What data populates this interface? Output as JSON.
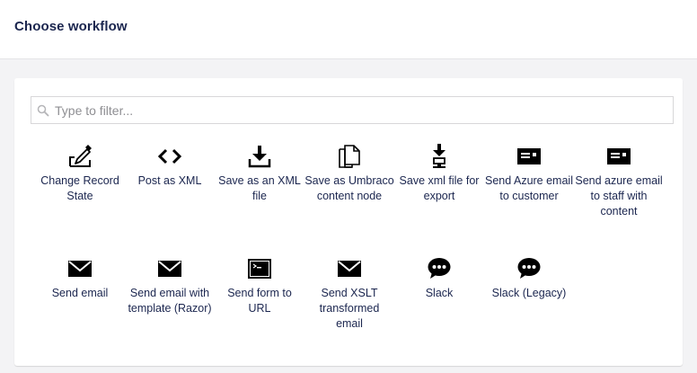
{
  "header": {
    "title": "Choose workflow"
  },
  "filter": {
    "placeholder": "Type to filter...",
    "value": ""
  },
  "workflows": [
    {
      "label": "Change Record State",
      "icon": "edit-record-icon"
    },
    {
      "label": "Post as XML",
      "icon": "code-icon"
    },
    {
      "label": "Save as an XML file",
      "icon": "download-tray-icon"
    },
    {
      "label": "Save as Umbraco content node",
      "icon": "documents-icon"
    },
    {
      "label": "Save xml file for export",
      "icon": "download-export-icon"
    },
    {
      "label": "Send Azure email to customer",
      "icon": "id-card-icon"
    },
    {
      "label": "Send azure email to staff with content",
      "icon": "id-card-icon"
    },
    {
      "label": "Send email",
      "icon": "envelope-icon"
    },
    {
      "label": "Send email with template (Razor)",
      "icon": "envelope-icon"
    },
    {
      "label": "Send form to URL",
      "icon": "terminal-window-icon"
    },
    {
      "label": "Send XSLT transformed email",
      "icon": "envelope-icon"
    },
    {
      "label": "Slack",
      "icon": "chat-bubble-icon"
    },
    {
      "label": "Slack (Legacy)",
      "icon": "chat-bubble-icon"
    }
  ]
}
